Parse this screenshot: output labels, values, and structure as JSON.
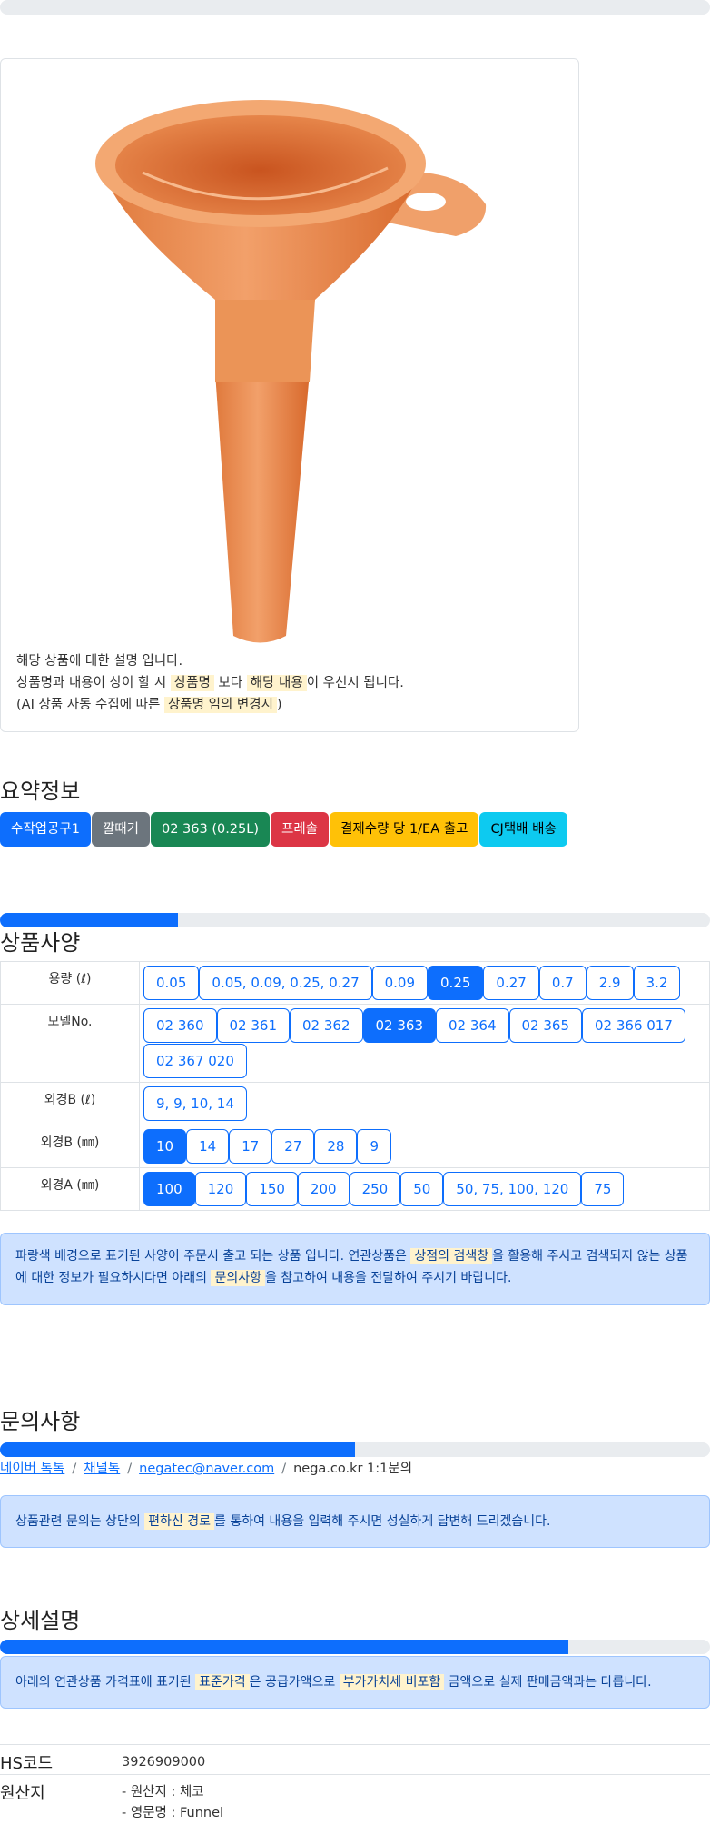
{
  "description": {
    "line1": "해당 상품에 대한 설명 입니다.",
    "line2_a": "상품명과 내용이 상이 할 시 ",
    "line2_hl1": "상품명",
    "line2_b": " 보다 ",
    "line2_hl2": "해당 내용",
    "line2_c": "이 우선시 됩니다.",
    "line3_a": "(AI 상품 자동 수집에 따른 ",
    "line3_hl": "상품명 임의 변경시",
    "line3_b": ")"
  },
  "summary": {
    "title": "요약정보",
    "badges": [
      {
        "label": "수작업공구1",
        "bg": "#0d6efd",
        "fg": "#ffffff"
      },
      {
        "label": "깔때기",
        "bg": "#6c757d",
        "fg": "#ffffff"
      },
      {
        "label": "02 363 (0.25L)",
        "bg": "#198754",
        "fg": "#ffffff"
      },
      {
        "label": "프레솔",
        "bg": "#dc3545",
        "fg": "#ffffff"
      },
      {
        "label": "결제수량 당 1/EA 출고",
        "bg": "#ffc107",
        "fg": "#000000"
      },
      {
        "label": "CJ택배 배송",
        "bg": "#0dcaf0",
        "fg": "#000000"
      }
    ]
  },
  "progress": {
    "spec": 0.25,
    "inquiry": 0.5,
    "detail": 0.8
  },
  "spec": {
    "title": "상품사양",
    "rows": [
      {
        "label": "용량 (ℓ)",
        "options": [
          "0.05",
          "0.05, 0.09, 0.25, 0.27",
          "0.09",
          "0.25",
          "0.27",
          "0.7",
          "2.9",
          "3.2"
        ],
        "selected": 3
      },
      {
        "label": "모델No.",
        "options": [
          "02 360",
          "02 361",
          "02 362",
          "02 363",
          "02 364",
          "02 365",
          "02 366 017",
          "02 367 020"
        ],
        "selected": 3
      },
      {
        "label": "외경B (ℓ)",
        "options": [
          "9, 9, 10, 14"
        ],
        "selected": -1
      },
      {
        "label": "외경B (㎜)",
        "options": [
          "10",
          "14",
          "17",
          "27",
          "28",
          "9"
        ],
        "selected": 0
      },
      {
        "label": "외경A (㎜)",
        "options": [
          "100",
          "120",
          "150",
          "200",
          "250",
          "50",
          "50, 75, 100, 120",
          "75"
        ],
        "selected": 0
      }
    ],
    "notice_a": "파랑색 배경으로 표기된 사양이 주문시 출고 되는 상품 입니다. 연관상품은 ",
    "notice_hl1": "상점의 검색창",
    "notice_b": "을 활용해 주시고 검색되지 않는 상품에 대한 정보가 필요하시다면 아래의 ",
    "notice_hl2": "문의사항",
    "notice_c": "을 참고하여 내용을 전달하여 주시기 바랍니다."
  },
  "inquiry": {
    "title": "문의사항",
    "links": [
      "네이버 톡톡",
      "채널톡",
      "negatec@naver.com"
    ],
    "plain": "nega.co.kr 1:1문의",
    "separator": "/",
    "notice_a": "상품관련 문의는 상단의 ",
    "notice_hl": "편하신 경로",
    "notice_b": "를 통하여 내용을 입력해 주시면 성실하게 답변해 드리겠습니다."
  },
  "detail": {
    "title": "상세설명",
    "notice_a": "아래의 연관상품 가격표에 표기된 ",
    "notice_hl1": "표준가격",
    "notice_b": "은 공급가액으로 ",
    "notice_hl2": "부가가치세 비포함",
    "notice_c": " 금액으로 실제 판매금액과는 다릅니다.",
    "hs_label": "HS코드",
    "hs_value": "3926909000",
    "origin_label": "원산지",
    "origin_line1": "- 원산지 : 체코",
    "origin_line2": "- 영문명 : Funnel"
  },
  "colors": {
    "primary": "#0d6efd",
    "funnel": "#e9874a"
  }
}
